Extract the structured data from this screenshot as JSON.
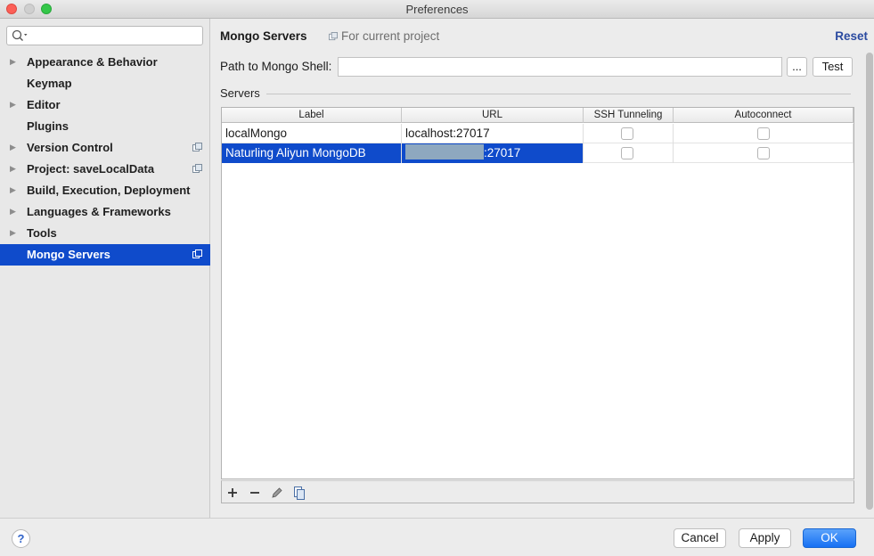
{
  "window": {
    "title": "Preferences"
  },
  "sidebar": {
    "search_placeholder": "",
    "items": [
      {
        "label": "Appearance & Behavior",
        "expandable": true,
        "project_icon": false
      },
      {
        "label": "Keymap",
        "expandable": false,
        "project_icon": false
      },
      {
        "label": "Editor",
        "expandable": true,
        "project_icon": false
      },
      {
        "label": "Plugins",
        "expandable": false,
        "project_icon": false
      },
      {
        "label": "Version Control",
        "expandable": true,
        "project_icon": true
      },
      {
        "label": "Project: saveLocalData",
        "expandable": true,
        "project_icon": true
      },
      {
        "label": "Build, Execution, Deployment",
        "expandable": true,
        "project_icon": false
      },
      {
        "label": "Languages & Frameworks",
        "expandable": true,
        "project_icon": false
      },
      {
        "label": "Tools",
        "expandable": true,
        "project_icon": false
      },
      {
        "label": "Mongo Servers",
        "expandable": false,
        "project_icon": true,
        "selected": true
      }
    ]
  },
  "main": {
    "title": "Mongo Servers",
    "scope": "For current project",
    "reset": "Reset",
    "path_label": "Path to Mongo Shell:",
    "path_value": "",
    "browse_label": "...",
    "test_label": "Test",
    "servers_section": "Servers"
  },
  "table": {
    "columns": [
      "Label",
      "URL",
      "SSH Tunneling",
      "Autoconnect"
    ],
    "rows": [
      {
        "label": "localMongo",
        "url": "localhost:27017",
        "ssh_tunneling": false,
        "autoconnect": false,
        "selected": false
      },
      {
        "label": "Naturling Aliyun MongoDB",
        "url": ":27017",
        "url_redacted": true,
        "ssh_tunneling": false,
        "autoconnect": false,
        "selected": true
      }
    ],
    "toolbar": [
      "add-icon",
      "remove-icon",
      "edit-icon",
      "copy-icon"
    ]
  },
  "footer": {
    "help": "?",
    "cancel": "Cancel",
    "apply": "Apply",
    "ok": "OK"
  },
  "colors": {
    "selection": "#0f4bcb",
    "link": "#2a4aa0",
    "primary_button": "#1670f3"
  }
}
